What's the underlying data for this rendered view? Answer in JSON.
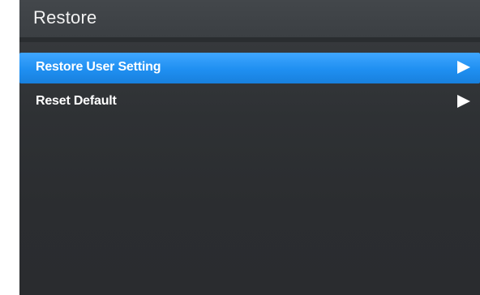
{
  "header": {
    "title": "Restore"
  },
  "menu": {
    "items": [
      {
        "label": "Restore User Setting",
        "selected": true,
        "icon": "triangle-right-icon"
      },
      {
        "label": "Reset Default",
        "selected": false,
        "icon": "triangle-right-icon"
      }
    ]
  },
  "colors": {
    "highlight": "#1f8ff1",
    "background": "#2e3134",
    "text": "#ffffff"
  }
}
